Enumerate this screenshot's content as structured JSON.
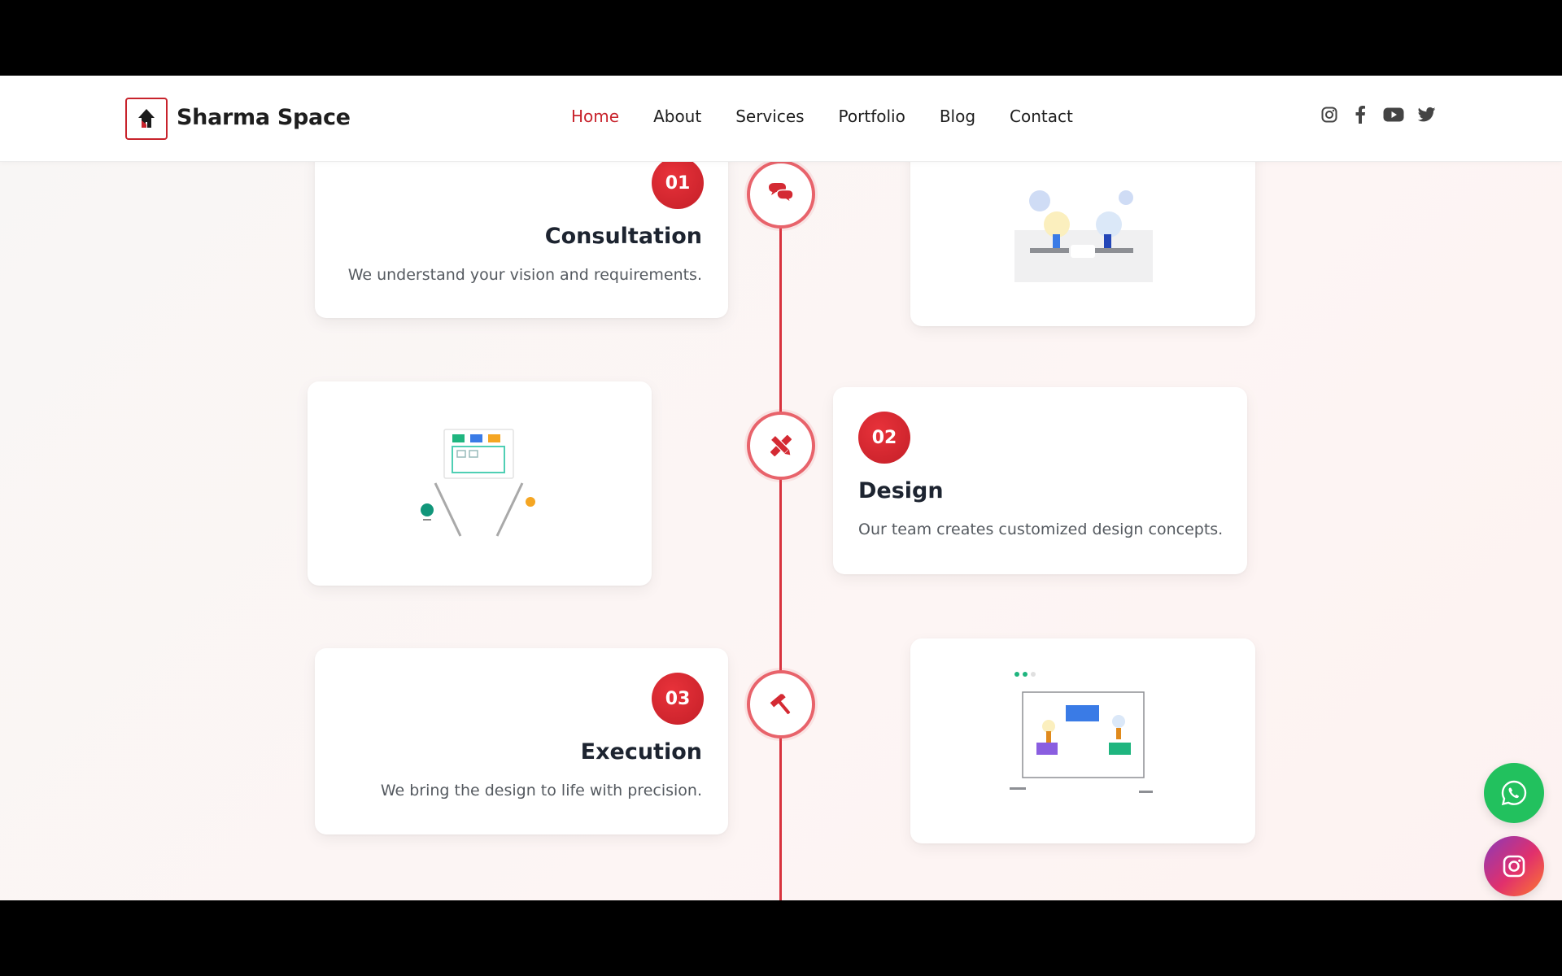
{
  "header": {
    "brand": "Sharma Space",
    "nav": [
      {
        "label": "Home",
        "active": true
      },
      {
        "label": "About",
        "active": false
      },
      {
        "label": "Services",
        "active": false
      },
      {
        "label": "Portfolio",
        "active": false
      },
      {
        "label": "Blog",
        "active": false
      },
      {
        "label": "Contact",
        "active": false
      }
    ],
    "socials": [
      "instagram-icon",
      "facebook-icon",
      "youtube-icon",
      "twitter-icon"
    ]
  },
  "process": {
    "steps": [
      {
        "number": "01",
        "title": "Consultation",
        "description": "We understand your vision and requirements.",
        "icon": "chat-bubbles-icon"
      },
      {
        "number": "02",
        "title": "Design",
        "description": "Our team creates customized design concepts.",
        "icon": "pencil-ruler-icon"
      },
      {
        "number": "03",
        "title": "Execution",
        "description": "We bring the design to life with precision.",
        "icon": "hammer-icon"
      }
    ]
  },
  "floating": {
    "whatsapp": "whatsapp-icon",
    "instagram": "instagram-icon"
  },
  "colors": {
    "accent": "#c8232c",
    "timeline": "#d8333e",
    "whatsapp": "#22c15e"
  }
}
